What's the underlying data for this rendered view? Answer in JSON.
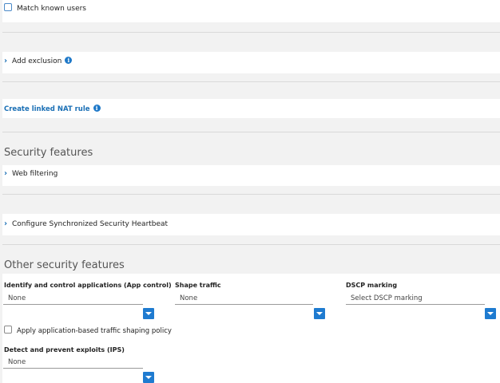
{
  "match_users": {
    "label": "Match known users"
  },
  "exclusion": {
    "label": "Add exclusion"
  },
  "nat": {
    "label": "Create linked NAT rule"
  },
  "security_features": {
    "title": "Security features",
    "web_filtering": "Web filtering",
    "heartbeat": "Configure Synchronized Security Heartbeat"
  },
  "other_features": {
    "title": "Other security features",
    "app_control": {
      "label": "Identify and control applications (App control)",
      "value": "None"
    },
    "shape_traffic": {
      "label": "Shape traffic",
      "value": "None"
    },
    "dscp": {
      "label": "DSCP marking",
      "value": "Select DSCP marking"
    },
    "app_shaping": {
      "label": "Apply application-based traffic shaping policy"
    },
    "ips": {
      "label": "Detect and prevent exploits (IPS)",
      "value": "None"
    }
  },
  "colors": {
    "accent": "#1f7bd0",
    "link": "#1a6fb5",
    "background": "#f2f2f2"
  }
}
